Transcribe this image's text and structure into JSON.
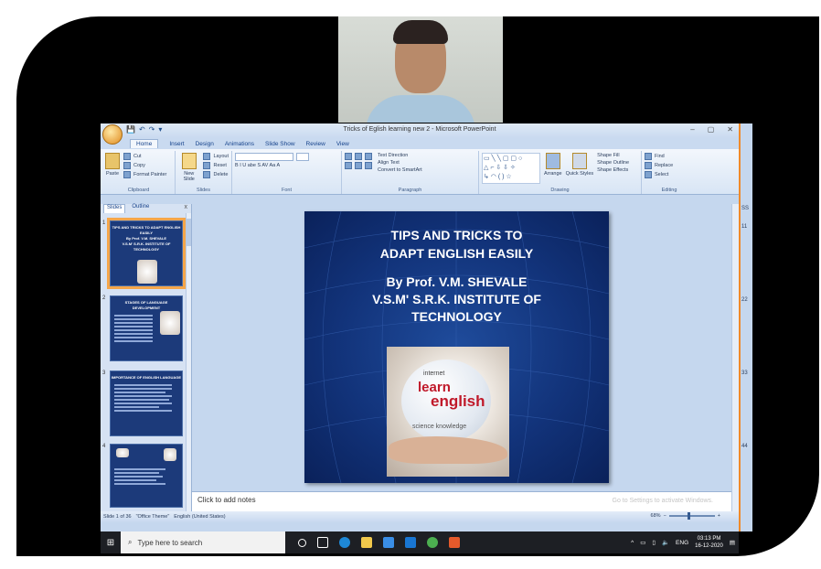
{
  "app": {
    "window_title": "Tricks of Eglish learning new 2 - Microsoft PowerPoint",
    "window_controls": [
      "–",
      "▢",
      "✕"
    ],
    "qat": [
      "💾",
      "↶",
      "↷",
      "▾"
    ]
  },
  "tabs": [
    "Home",
    "Insert",
    "Design",
    "Animations",
    "Slide Show",
    "Review",
    "View"
  ],
  "ribbon": {
    "clipboard": {
      "label": "Clipboard",
      "paste": "Paste",
      "cut": "Cut",
      "copy": "Copy",
      "format_painter": "Format Painter"
    },
    "slides": {
      "label": "Slides",
      "new_slide": "New Slide",
      "layout": "Layout",
      "reset": "Reset",
      "delete": "Delete"
    },
    "font": {
      "label": "Font",
      "buttons": "B  I  U  abe  S  AV  Aa  A"
    },
    "paragraph": {
      "label": "Paragraph",
      "text_direction": "Text Direction",
      "align_text": "Align Text",
      "convert": "Convert to SmartArt"
    },
    "drawing": {
      "label": "Drawing",
      "arrange": "Arrange",
      "quick_styles": "Quick Styles",
      "shape_fill": "Shape Fill",
      "shape_outline": "Shape Outline",
      "shape_effects": "Shape Effects"
    },
    "editing": {
      "label": "Editing",
      "find": "Find",
      "replace": "Replace",
      "select": "Select"
    }
  },
  "pane": {
    "tab_slides": "Slides",
    "tab_outline": "Outline",
    "close": "x",
    "thumbs": [
      {
        "num": "1",
        "title": "TIPS AND TRICKS TO ADAPT ENGLISH EASILY\nBy Prof. V.M. SHEVALE\nV.S.M' S.R.K. INSTITUTE OF TECHNOLOGY"
      },
      {
        "num": "2",
        "title": "STAGES OF LANGUAGE DEVELOPMENT"
      },
      {
        "num": "3",
        "title": "IMPORTANCE OF ENGLISH LANGUAGE"
      },
      {
        "num": "4",
        "title": ""
      }
    ]
  },
  "slide": {
    "title": "TIPS AND TRICKS TO ADAPT ENGLISH EASILY",
    "author": "By Prof. V.M. SHEVALE",
    "institute": "V.S.M' S.R.K. INSTITUTE OF TECHNOLOGY",
    "image_words": [
      "learn",
      "english",
      "science knowledge",
      "internet"
    ]
  },
  "notes": {
    "placeholder": "Click to add notes",
    "watermark": "Go to Settings to activate Windows."
  },
  "status": {
    "slide": "Slide 1 of 36",
    "theme": "\"Office Theme\"",
    "language": "English (United States)",
    "zoom": "68%"
  },
  "taskbar": {
    "search_placeholder": "Type here to search",
    "lang": "ENG",
    "time": "03:13 PM",
    "date": "16-12-2020"
  },
  "side_strip": [
    "SS",
    "11",
    "22",
    "33",
    "44"
  ]
}
